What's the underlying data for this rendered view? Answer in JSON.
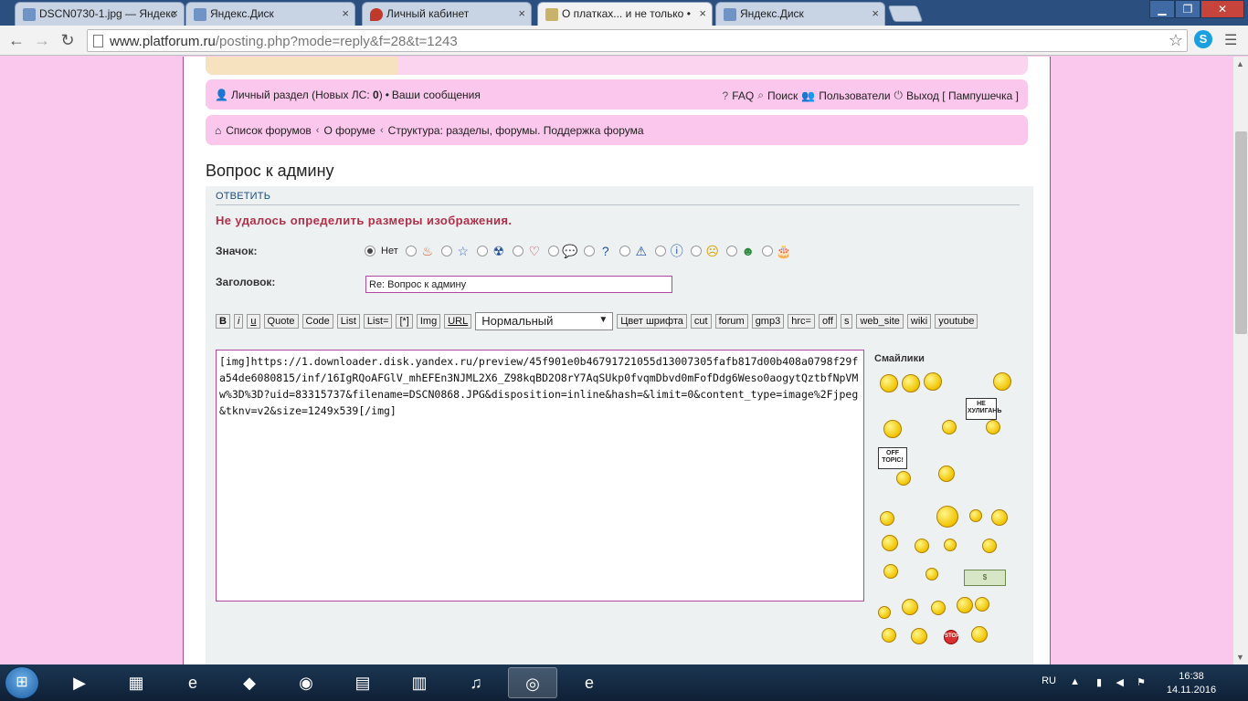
{
  "browser": {
    "tabs": [
      {
        "title": "DSCN0730-1.jpg — Яндекс",
        "active": false
      },
      {
        "title": "Яндекс.Диск",
        "active": false
      },
      {
        "title": "Личный кабинет",
        "active": false
      },
      {
        "title": "О платках... и не только •",
        "active": true
      },
      {
        "title": "Яндекс.Диск",
        "active": false
      }
    ],
    "url_host": "www.platforum.ru",
    "url_path": "/posting.php?mode=reply&f=28&t=1243",
    "window_buttons": {
      "minimize": "▁",
      "maximize": "❐",
      "close": "✕"
    }
  },
  "nav": {
    "private_section": "Личный раздел (Новых ЛС: ",
    "pm_count": "0",
    "private_close": ")",
    "bullet": "•",
    "your_messages": "Ваши сообщения",
    "faq": "FAQ",
    "search": "Поиск",
    "users": "Пользователи",
    "logout": "Выход [ Пампушечка ]"
  },
  "breadcrumb": {
    "items": [
      "Список форумов",
      "О форуме",
      "Структура: разделы, форумы. Поддержка форума"
    ],
    "separator": "‹"
  },
  "topic_title": "Вопрос к админу",
  "form": {
    "reply_tab": "ОТВЕТИТЬ",
    "error": "Не удалось определить размеры изображения.",
    "icon_label": "Значок:",
    "icon_none": "Нет",
    "subject_label": "Заголовок:",
    "subject_value": "Re: Вопрос к админу",
    "buttons": {
      "b": "B",
      "i": "i",
      "u": "u",
      "quote": "Quote",
      "code": "Code",
      "list": "List",
      "list_eq": "List=",
      "star": "[*]",
      "img": "Img",
      "url": "URL",
      "font_color": "Цвет шрифта",
      "cut": "cut",
      "forum": "forum",
      "gmp3": "gmp3",
      "hrc": "hrc=",
      "off": "off",
      "s": "s",
      "web_site": "web_site",
      "wiki": "wiki",
      "youtube": "youtube"
    },
    "font_size": "Нормальный",
    "message": "[img]https://1.downloader.disk.yandex.ru/preview/45f901e0b46791721055d13007305fafb817d00b408a0798f29fa54de6080815/inf/16IgRQoAFGlV_mhEFEn3NJML2X6_Z98kqBD2O8rY7AqSUkp0fvqmDbvd0mFofDdg6Weso0aogytQztbfNpVMw%3D%3D?uid=83315737&filename=DSCN0868.JPG&disposition=inline&hash=&limit=0&content_type=image%2Fjpeg&tknv=v2&size=1249x539[/img]",
    "smilies_title": "Смайлики",
    "sign_hooligan": "НЕ ХУЛИГАНЬ",
    "sign_offtopic": "OFF TOPIC!",
    "sign_stop": "STOP"
  },
  "taskbar": {
    "lang": "RU",
    "time": "16:38",
    "date": "14.11.2016"
  }
}
